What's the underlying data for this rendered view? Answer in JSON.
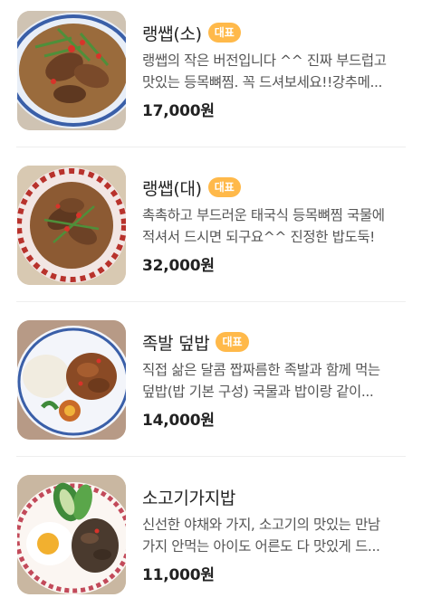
{
  "menu_items": [
    {
      "name": "랭쌥(소)",
      "badge": "대표",
      "description_lines": [
        "랭쌥의 작은 버전입니다 ^^ 진짜 부드럽고",
        "맛있는 등목뼈찜. 꼭 드셔보세요!!강추메..."
      ],
      "price": "17,000원",
      "image_icon": "pork-bone-stew-plate-icon"
    },
    {
      "name": "랭쌥(대)",
      "badge": "대표",
      "description_lines": [
        "촉촉하고 부드러운 태국식 등목뼈찜 국물에",
        "적셔서 드시면 되구요^^ 진정한 밥도둑!"
      ],
      "price": "32,000원",
      "image_icon": "large-pork-bone-stew-plate-icon"
    },
    {
      "name": "족발 덮밥",
      "badge": "대표",
      "description_lines": [
        "직접 삶은 달콤 짭짜름한 족발과 함께 먹는",
        "덮밥(밥 기본 구성) 국물과 밥이랑 같이..."
      ],
      "price": "14,000원",
      "image_icon": "pork-trotter-rice-icon"
    },
    {
      "name": "소고기가지밥",
      "badge": "",
      "description_lines": [
        "신선한 야채와 가지, 소고기의 맛있는 만남",
        "가지 안먹는 아이도 어른도 다 맛있게 드..."
      ],
      "price": "11,000원",
      "image_icon": "beef-eggplant-rice-icon"
    }
  ],
  "colors": {
    "badge": "#ffb94a",
    "text": "#222222",
    "description": "#555555",
    "divider": "#eeeeee"
  }
}
